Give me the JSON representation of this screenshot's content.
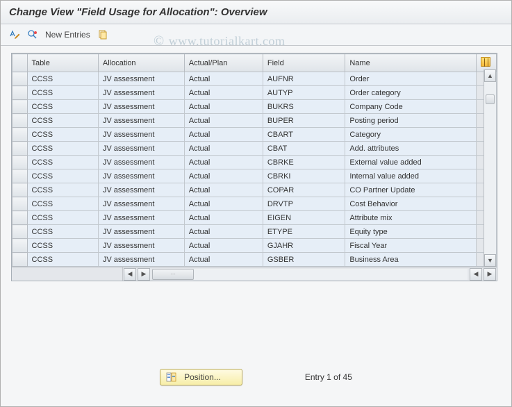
{
  "title": "Change View \"Field Usage for Allocation\": Overview",
  "toolbar": {
    "new_entries_label": "New Entries"
  },
  "columns": {
    "table": "Table",
    "allocation": "Allocation",
    "actual_plan": "Actual/Plan",
    "field": "Field",
    "name": "Name"
  },
  "rows": [
    {
      "table": "CCSS",
      "allocation": "JV assessment",
      "actual_plan": "Actual",
      "field": "AUFNR",
      "name": "Order"
    },
    {
      "table": "CCSS",
      "allocation": "JV assessment",
      "actual_plan": "Actual",
      "field": "AUTYP",
      "name": "Order category"
    },
    {
      "table": "CCSS",
      "allocation": "JV assessment",
      "actual_plan": "Actual",
      "field": "BUKRS",
      "name": "Company Code"
    },
    {
      "table": "CCSS",
      "allocation": "JV assessment",
      "actual_plan": "Actual",
      "field": "BUPER",
      "name": "Posting period"
    },
    {
      "table": "CCSS",
      "allocation": "JV assessment",
      "actual_plan": "Actual",
      "field": "CBART",
      "name": "Category"
    },
    {
      "table": "CCSS",
      "allocation": "JV assessment",
      "actual_plan": "Actual",
      "field": "CBAT",
      "name": "Add. attributes"
    },
    {
      "table": "CCSS",
      "allocation": "JV assessment",
      "actual_plan": "Actual",
      "field": "CBRKE",
      "name": "External value added"
    },
    {
      "table": "CCSS",
      "allocation": "JV assessment",
      "actual_plan": "Actual",
      "field": "CBRKI",
      "name": "Internal value added"
    },
    {
      "table": "CCSS",
      "allocation": "JV assessment",
      "actual_plan": "Actual",
      "field": "COPAR",
      "name": "CO Partner Update"
    },
    {
      "table": "CCSS",
      "allocation": "JV assessment",
      "actual_plan": "Actual",
      "field": "DRVTP",
      "name": "Cost Behavior"
    },
    {
      "table": "CCSS",
      "allocation": "JV assessment",
      "actual_plan": "Actual",
      "field": "EIGEN",
      "name": "Attribute mix"
    },
    {
      "table": "CCSS",
      "allocation": "JV assessment",
      "actual_plan": "Actual",
      "field": "ETYPE",
      "name": "Equity type"
    },
    {
      "table": "CCSS",
      "allocation": "JV assessment",
      "actual_plan": "Actual",
      "field": "GJAHR",
      "name": "Fiscal Year"
    },
    {
      "table": "CCSS",
      "allocation": "JV assessment",
      "actual_plan": "Actual",
      "field": "GSBER",
      "name": "Business Area"
    }
  ],
  "footer": {
    "position_label": "Position...",
    "entry_label": "Entry 1 of 45"
  },
  "watermark": "www.tutorialkart.com"
}
